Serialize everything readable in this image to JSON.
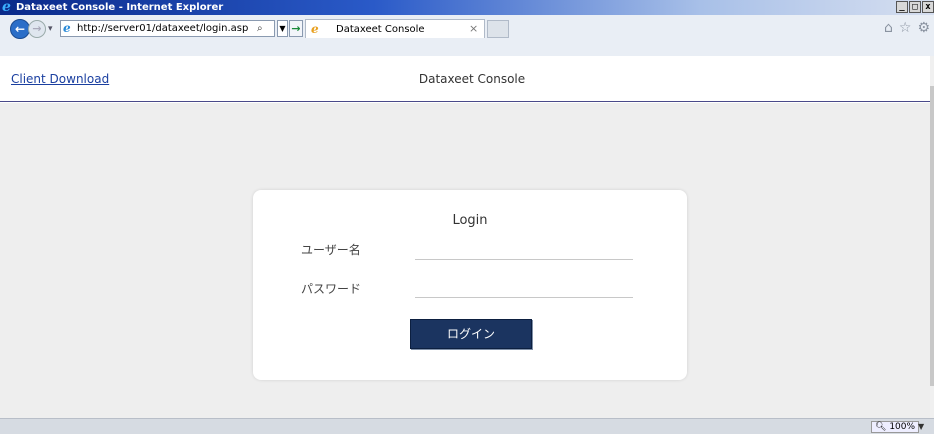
{
  "window": {
    "title": "Dataxeet Console - Internet Explorer",
    "minimize": "_",
    "maximize": "□",
    "close": "x"
  },
  "navbar": {
    "address_url": "http://server01/dataxeet/login.asp",
    "tab_label": "Dataxeet Console",
    "tab_close": "×",
    "icons": [
      "home-icon",
      "favorites-star-icon",
      "gear-icon"
    ]
  },
  "page": {
    "client_download": "Client Download",
    "header_title": "Dataxeet Console",
    "login": {
      "title": "Login",
      "username_label": "ユーザー名",
      "password_label": "パスワード",
      "username_value": "",
      "password_value": "",
      "submit_label": "ログイン"
    }
  },
  "statusbar": {
    "zoom": "100%"
  },
  "colors": {
    "login_button": "#1b3460",
    "link": "#1a3fa0",
    "header_rule": "#4a4a8a",
    "page_background": "#eeeeee"
  }
}
